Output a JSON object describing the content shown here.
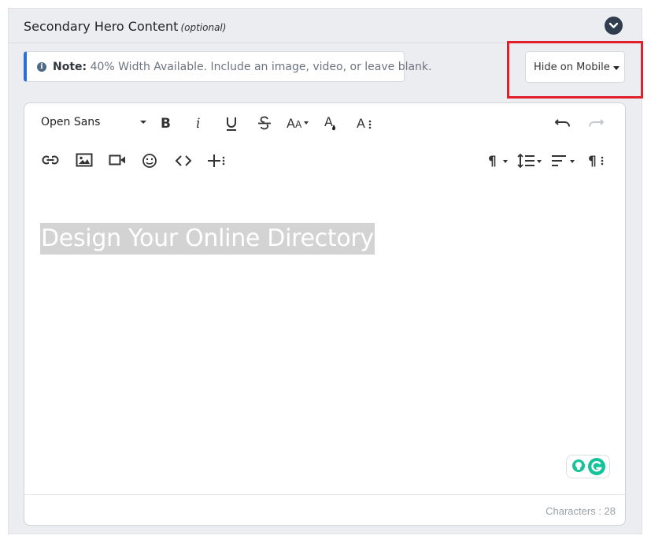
{
  "panel": {
    "title": "Secondary Hero Content",
    "title_suffix": "(optional)"
  },
  "note": {
    "label": "Note:",
    "text": " 40% Width Available. Include an image, video, or leave blank."
  },
  "visibility_select": {
    "selected": "Hide on Mobile"
  },
  "toolbar": {
    "font_family": "Open Sans",
    "row1": [
      "bold-icon",
      "italic-icon",
      "underline-icon",
      "strikethrough-icon",
      "font-size-icon",
      "text-color-icon",
      "more-text-icon",
      "undo-icon",
      "redo-icon"
    ],
    "row2": [
      "link-icon",
      "image-icon",
      "video-icon",
      "emoji-icon",
      "code-view-icon",
      "more-insert-icon",
      "paragraph-format-icon",
      "line-height-icon",
      "align-icon",
      "more-paragraph-icon"
    ]
  },
  "editor": {
    "content": "Design Your Online Directory",
    "char_count": "Characters : 28"
  },
  "colors": {
    "accent_border": "#2b6fd6",
    "highlight_red": "#e0202a",
    "grammarly_green": "#15c39a"
  }
}
